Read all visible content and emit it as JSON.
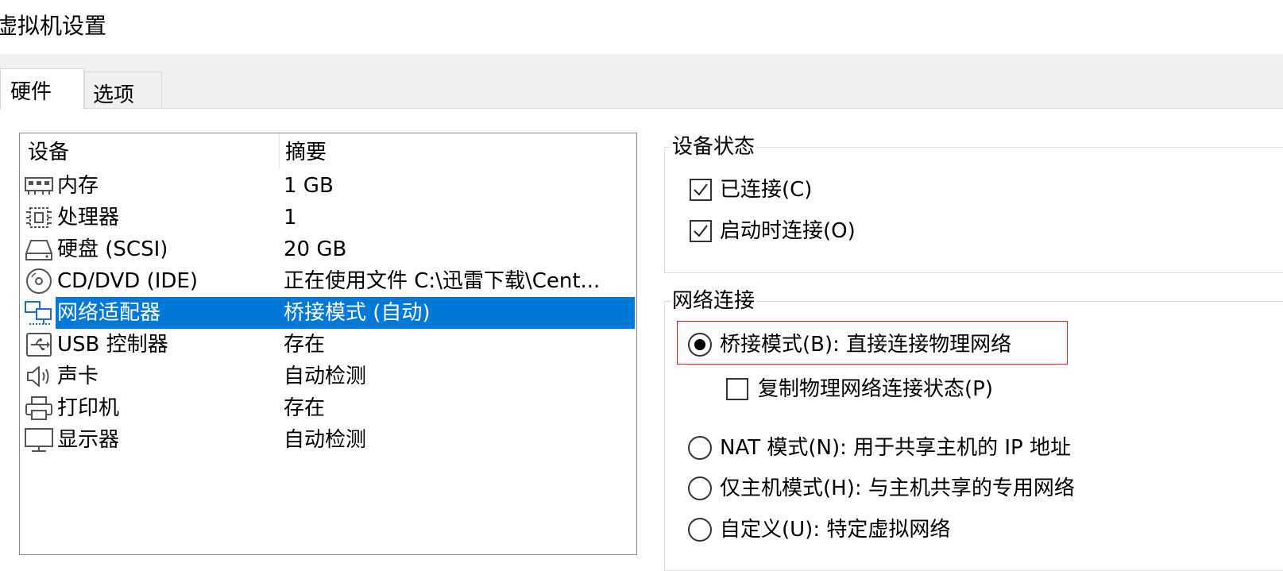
{
  "window": {
    "title": "虚拟机设置"
  },
  "tabs": [
    {
      "label": "硬件"
    },
    {
      "label": "选项"
    }
  ],
  "device_list": {
    "headers": {
      "device": "设备",
      "summary": "摘要"
    },
    "rows": [
      {
        "name": "内存",
        "summary": "1 GB",
        "icon": "memory-icon"
      },
      {
        "name": "处理器",
        "summary": "1",
        "icon": "processor-icon"
      },
      {
        "name": "硬盘 (SCSI)",
        "summary": "20 GB",
        "icon": "hard-disk-icon"
      },
      {
        "name": "CD/DVD (IDE)",
        "summary": "正在使用文件 C:\\迅雷下载\\Cent...",
        "icon": "cd-dvd-icon"
      },
      {
        "name": "网络适配器",
        "summary": "桥接模式 (自动)",
        "icon": "network-adapter-icon",
        "selected": true
      },
      {
        "name": "USB 控制器",
        "summary": "存在",
        "icon": "usb-icon"
      },
      {
        "name": "声卡",
        "summary": "自动检测",
        "icon": "speaker-icon"
      },
      {
        "name": "打印机",
        "summary": "存在",
        "icon": "printer-icon"
      },
      {
        "name": "显示器",
        "summary": "自动检测",
        "icon": "monitor-icon"
      }
    ]
  },
  "device_status": {
    "label": "设备状态",
    "connected": {
      "label": "已连接(C)",
      "checked": true
    },
    "connect_on_start": {
      "label": "启动时连接(O)",
      "checked": true
    }
  },
  "network": {
    "label": "网络连接",
    "bridged": {
      "label": "桥接模式(B): 直接连接物理网络",
      "selected": true
    },
    "replicate": {
      "label": "复制物理网络连接状态(P)",
      "checked": false
    },
    "nat": {
      "label": "NAT 模式(N): 用于共享主机的 IP 地址",
      "selected": false
    },
    "host_only": {
      "label": "仅主机模式(H): 与主机共享的专用网络",
      "selected": false
    },
    "custom": {
      "label": "自定义(U): 特定虚拟网络",
      "selected": false
    }
  },
  "colors": {
    "selection": "#0078d7",
    "highlight_box": "#e02020"
  }
}
